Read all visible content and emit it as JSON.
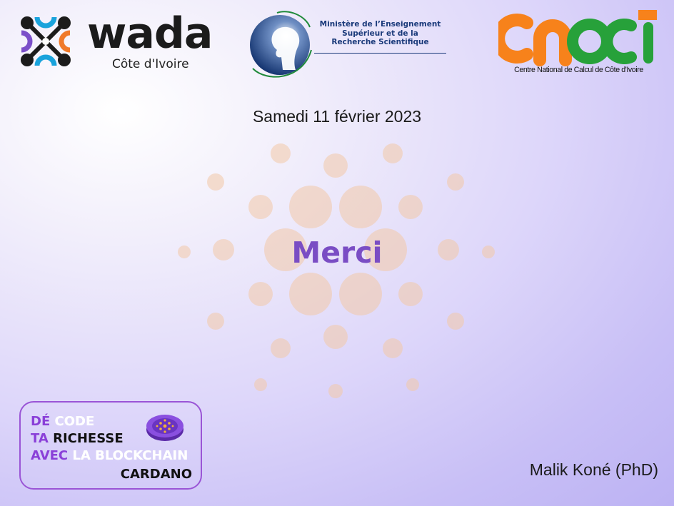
{
  "logos": {
    "wada": {
      "word": "wada",
      "subtitle": "Côte d'Ivoire"
    },
    "ministry": {
      "line1": "Ministère de l’Enseignement",
      "line2": "Supérieur et de la",
      "line3": "Recherche Scientifique"
    },
    "cncci": {
      "caption": "Centre National de Calcul de Côte d'Ivoire"
    }
  },
  "slide": {
    "date": "Samedi 11 février 2023",
    "title": "Merci",
    "author": "Malik Koné (PhD)"
  },
  "badge": {
    "w1": "DÉ",
    "w2": "CODE",
    "w3": "TA",
    "w4": "RICHESSE",
    "w5": "AVEC",
    "w6": "LA BLOCKCHAIN",
    "w7": "CARDANO"
  },
  "colors": {
    "title": "#7a4dc4",
    "badge_purple": "#8a3fd8",
    "cncci_orange": "#f7821b",
    "cncci_green": "#27a13a",
    "wada_purple": "#7b4fc9",
    "wada_orange": "#f07a2a",
    "wada_blue": "#1aa3dc"
  }
}
